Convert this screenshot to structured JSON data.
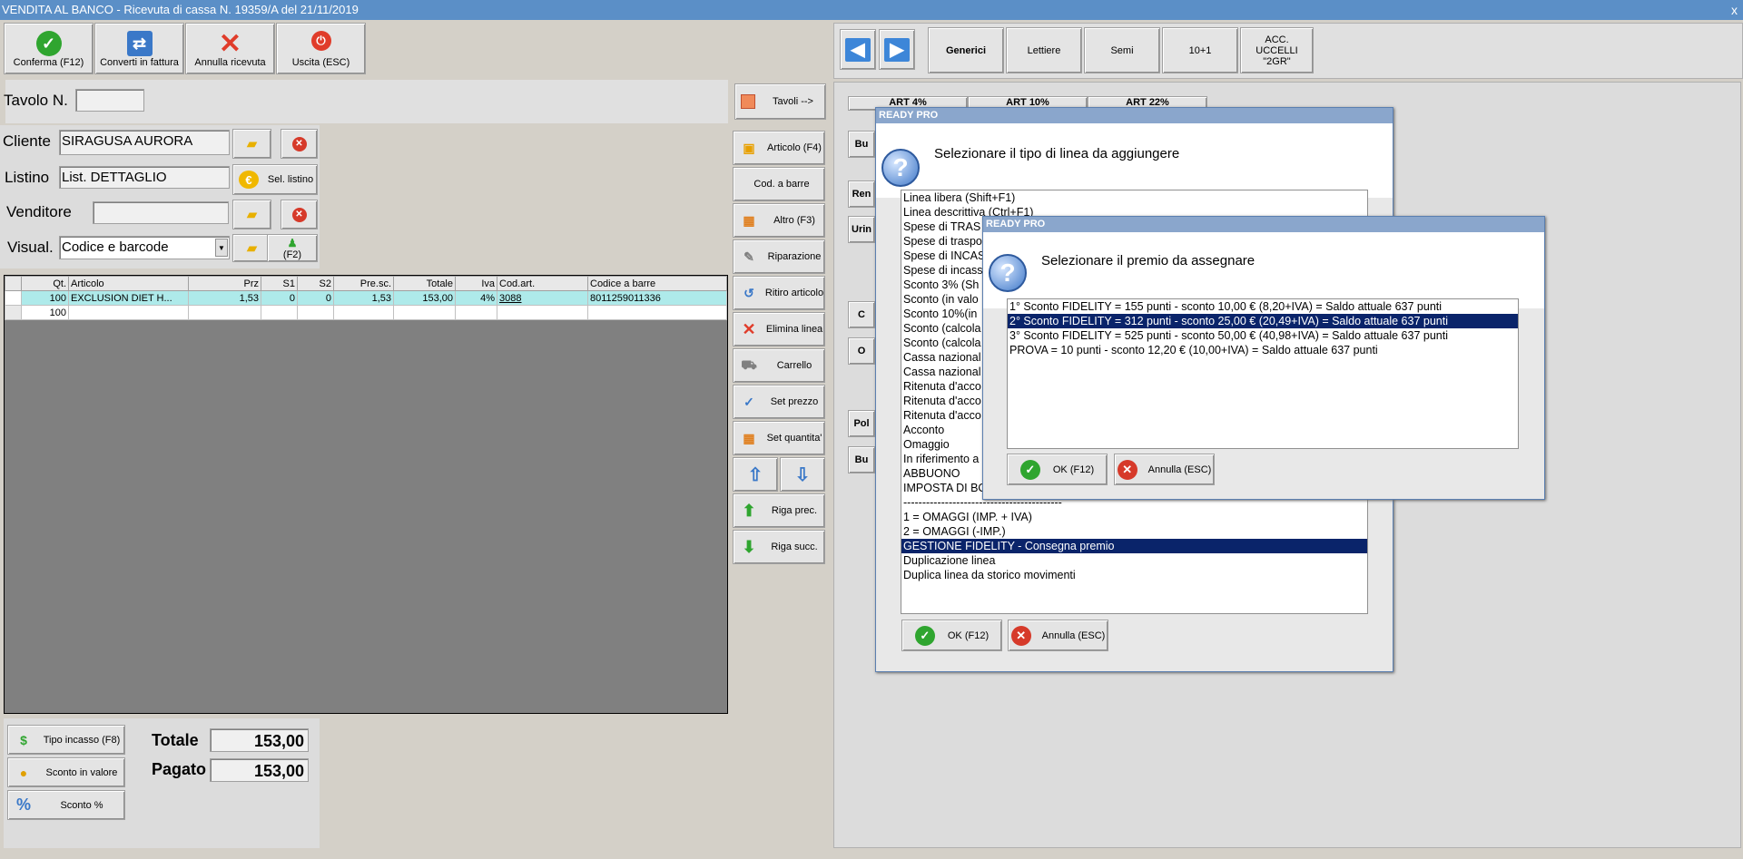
{
  "window": {
    "title": "VENDITA AL BANCO - Ricevuta di cassa N. 19359/A del 21/11/2019",
    "close": "x"
  },
  "toolbar": [
    {
      "label": "Conferma (F12)",
      "icon": "check-icon",
      "color": "#2fa52f"
    },
    {
      "label": "Converti in fattura",
      "icon": "convert-icon",
      "color": "#3a78c8"
    },
    {
      "label": "Annulla ricevuta",
      "icon": "x-icon",
      "color": "#e03c2a"
    },
    {
      "label": "Uscita (ESC)",
      "icon": "exit-icon",
      "color": "#e03c2a"
    }
  ],
  "form": {
    "tavolo_label": "Tavolo N.",
    "tavolo_value": "",
    "tavoli_button": "Tavoli -->",
    "cliente_label": "Cliente",
    "cliente_value": "SIRAGUSA AURORA",
    "listino_label": "Listino",
    "listino_value": "List. DETTAGLIO",
    "sel_listino": "Sel. listino",
    "venditore_label": "Venditore",
    "venditore_value": "",
    "visual_label": "Visual.",
    "visual_value": "Codice e barcode",
    "f2_label": "(F2)"
  },
  "grid": {
    "headers": [
      "Qt.",
      "Articolo",
      "Prz",
      "S1",
      "S2",
      "Pre.sc.",
      "Totale",
      "Iva",
      "Cod.art.",
      "Codice a barre"
    ],
    "rows": [
      [
        "100",
        "EXCLUSION DIET H...",
        "1,53",
        "0",
        "0",
        "1,53",
        "153,00",
        "4%",
        "3088",
        "8011259011336"
      ],
      [
        "100",
        "",
        "",
        "",
        "",
        "",
        "",
        "",
        "",
        ""
      ]
    ]
  },
  "side_buttons": [
    "Articolo (F4)",
    "Cod. a barre",
    "Altro (F3)",
    "Riparazione",
    "Ritiro articolo",
    "Elimina linea",
    "Carrello",
    "Set prezzo",
    "Set quantita'",
    "",
    "Riga prec.",
    "Riga succ."
  ],
  "bottom": {
    "tipo_incasso": "Tipo incasso (F8)",
    "sconto_valore": "Sconto in valore",
    "sconto_perc": "Sconto %",
    "totale_label": "Totale",
    "totale_value": "153,00",
    "pagato_label": "Pagato",
    "pagato_value": "153,00"
  },
  "categories": [
    "Generici",
    "Lettiere",
    "Semi",
    "10+1",
    "ACC. UCCELLI \"2GR\""
  ],
  "bg_labels": [
    "ART 4%",
    "ART 10%",
    "ART 22%",
    "Bu",
    "Ren",
    "Urin",
    "C",
    "O",
    "Pol",
    "Bu"
  ],
  "dialog1": {
    "header": "READY PRO",
    "question": "Selezionare il tipo di linea da aggiungere",
    "items": [
      "Linea libera (Shift+F1)",
      "Linea descrittiva (Ctrl+F1)",
      "Spese di TRAS",
      "Spese di traspo",
      "Spese di INCAS",
      "Spese di incass",
      "Sconto 3% (Sh",
      "Sconto (in valo",
      "Sconto 10%(in",
      "Sconto (calcola",
      "Sconto (calcola",
      "Cassa nazional",
      "Cassa nazional",
      "Ritenuta d'acco",
      "Ritenuta d'acco",
      "Ritenuta d'acco",
      "Acconto",
      "Omaggio",
      "In riferimento a",
      "ABBUONO",
      "IMPOSTA DI BO",
      "------------------------------------------",
      "1 = OMAGGI (IMP. + IVA)",
      "2 = OMAGGI (-IMP.)",
      "GESTIONE FIDELITY - Consegna premio",
      "Duplicazione linea",
      "Duplica linea da storico movimenti"
    ],
    "selected_index": 24,
    "ok": "OK (F12)",
    "cancel": "Annulla (ESC)"
  },
  "dialog2": {
    "header": "READY PRO",
    "question": "Selezionare il premio da assegnare",
    "items": [
      "1° Sconto FIDELITY = 155 punti  - sconto 10,00 € (8,20+IVA) = Saldo attuale 637 punti",
      "2° Sconto FIDELITY = 312 punti  - sconto 25,00 € (20,49+IVA) = Saldo attuale 637 punti",
      "3° Sconto FIDELITY = 525 punti  - sconto 50,00 € (40,98+IVA) = Saldo attuale 637 punti",
      "PROVA = 10 punti  - sconto 12,20 € (10,00+IVA) = Saldo attuale 637 punti"
    ],
    "selected_index": 1,
    "ok": "OK (F12)",
    "cancel": "Annulla (ESC)"
  }
}
